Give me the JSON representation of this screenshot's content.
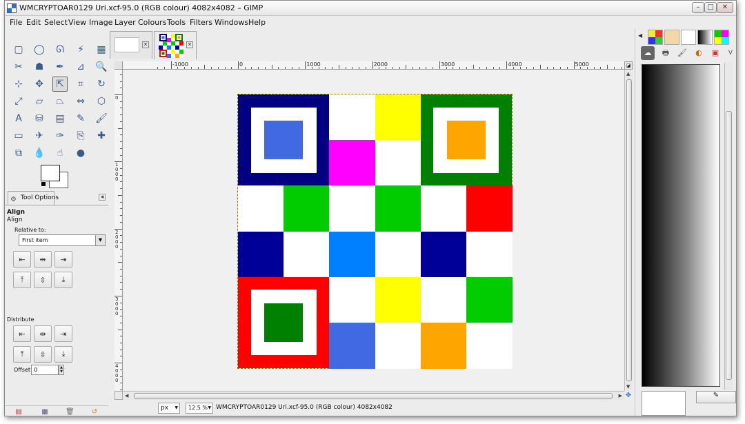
{
  "window": {
    "title": "WMCRYPTOAR0129 Uri.xcf-95.0 (RGB colour) 4082x4082 – GIMP",
    "controls": {
      "minimize": "–",
      "maximize": "□",
      "close": "✕"
    }
  },
  "menubar": {
    "items": [
      "File",
      "Edit",
      "Select",
      "View",
      "Image",
      "Layer",
      "Colours",
      "Tools",
      "Filters",
      "Windows",
      "Help"
    ]
  },
  "toolbox": {
    "tools": [
      {
        "icon": "rect-select-icon",
        "glyph": "▢"
      },
      {
        "icon": "ellipse-select-icon",
        "glyph": "◯"
      },
      {
        "icon": "free-select-icon",
        "glyph": "ᘏ"
      },
      {
        "icon": "fuzzy-select-icon",
        "glyph": "⚡"
      },
      {
        "icon": "color-select-icon",
        "glyph": "▦"
      },
      {
        "icon": "scissors-select-icon",
        "glyph": "✂"
      },
      {
        "icon": "foreground-select-icon",
        "glyph": "☗"
      },
      {
        "icon": "paths-icon",
        "glyph": "✒"
      },
      {
        "icon": "color-picker-icon",
        "glyph": "⊿"
      },
      {
        "icon": "zoom-icon",
        "glyph": "🔍"
      },
      {
        "icon": "measure-icon",
        "glyph": "⊹"
      },
      {
        "icon": "move-icon",
        "glyph": "✥"
      },
      {
        "icon": "align-icon",
        "glyph": "⇱"
      },
      {
        "icon": "crop-icon",
        "glyph": "⌗"
      },
      {
        "icon": "rotate-icon",
        "glyph": "↻"
      },
      {
        "icon": "scale-icon",
        "glyph": "⤢"
      },
      {
        "icon": "shear-icon",
        "glyph": "▱"
      },
      {
        "icon": "perspective-icon",
        "glyph": "⏢"
      },
      {
        "icon": "flip-icon",
        "glyph": "⇔"
      },
      {
        "icon": "cage-icon",
        "glyph": "⬡"
      },
      {
        "icon": "text-icon",
        "glyph": "A"
      },
      {
        "icon": "bucket-fill-icon",
        "glyph": "⛁"
      },
      {
        "icon": "blend-icon",
        "glyph": "▤"
      },
      {
        "icon": "pencil-icon",
        "glyph": "✎"
      },
      {
        "icon": "paintbrush-icon",
        "glyph": "🖌"
      },
      {
        "icon": "eraser-icon",
        "glyph": "▭"
      },
      {
        "icon": "airbrush-icon",
        "glyph": "✈"
      },
      {
        "icon": "ink-icon",
        "glyph": "✑"
      },
      {
        "icon": "clone-icon",
        "glyph": "⎘"
      },
      {
        "icon": "heal-icon",
        "glyph": "✚"
      },
      {
        "icon": "perspective-clone-icon",
        "glyph": "⧉"
      },
      {
        "icon": "blur-icon",
        "glyph": "💧"
      },
      {
        "icon": "smudge-icon",
        "glyph": "☝"
      },
      {
        "icon": "dodge-burn-icon",
        "glyph": "●"
      }
    ],
    "options_tab": "Tool Options",
    "align_title": "Align",
    "align_sub": "Align",
    "relative_to_label": "Relative to:",
    "relative_to_value": "First item",
    "align_buttons": [
      {
        "name": "align-left-edge-button",
        "glyph": "⇤"
      },
      {
        "name": "align-center-vertical-button",
        "glyph": "⇹"
      },
      {
        "name": "align-right-edge-button",
        "glyph": "⇥"
      },
      {
        "name": "align-top-edge-button",
        "glyph": "⤒"
      },
      {
        "name": "align-middle-horizontal-button",
        "glyph": "⇳"
      },
      {
        "name": "align-bottom-edge-button",
        "glyph": "⤓"
      }
    ],
    "distribute_label": "Distribute",
    "distribute_buttons": [
      {
        "name": "distribute-left-edges-button",
        "glyph": "⇤"
      },
      {
        "name": "distribute-centers-button",
        "glyph": "⇹"
      },
      {
        "name": "distribute-right-edges-button",
        "glyph": "⇥"
      },
      {
        "name": "distribute-top-edges-button",
        "glyph": "⤒"
      },
      {
        "name": "distribute-middles-button",
        "glyph": "⇳"
      },
      {
        "name": "distribute-bottom-edges-button",
        "glyph": "⤓"
      }
    ],
    "offset_label": "Offset:",
    "offset_value": "0"
  },
  "image_tabs": [
    {
      "name": "blank-image-tab",
      "close": "✕"
    },
    {
      "name": "qr-pattern-image-tab",
      "close": "✕"
    }
  ],
  "rulers": {
    "horizontal_labels": [
      "-1000",
      "0",
      "1000",
      "2000",
      "3000",
      "4000",
      "5000"
    ],
    "vertical_labels": [
      "0",
      "1000",
      "2000",
      "3000",
      "4000"
    ]
  },
  "image_grid": {
    "rows": [
      [
        "navy-pattern",
        "navy-pattern",
        "#ffffff",
        "#ffff00",
        "green-pattern",
        "green-pattern"
      ],
      [
        "navy-pattern",
        "navy-pattern",
        "#ff00ff",
        "#ffffff",
        "green-pattern",
        "green-pattern"
      ],
      [
        "#ffffff",
        "#00cc00",
        "#ffffff",
        "#00cc00",
        "#ffffff",
        "#ff0000"
      ],
      [
        "#000099",
        "#ffffff",
        "#0080ff",
        "#ffffff",
        "#000099",
        "#ffffff"
      ],
      [
        "red-pattern",
        "red-pattern",
        "#ffffff",
        "#ffff00",
        "#ffffff",
        "#00cc00"
      ],
      [
        "red-pattern",
        "red-pattern",
        "#4169e1",
        "#ffffff",
        "#ffa500",
        "#ffffff"
      ]
    ],
    "finder_patterns": [
      {
        "name": "navy-finder-pattern",
        "outer": "#000080",
        "inner": "#4169e1",
        "row": 0,
        "col": 0
      },
      {
        "name": "green-finder-pattern",
        "outer": "#008000",
        "inner": "#ffa500",
        "row": 0,
        "col": 4
      },
      {
        "name": "red-finder-pattern",
        "outer": "#ff0000",
        "inner": "#008000",
        "row": 4,
        "col": 0
      }
    ]
  },
  "statusbar": {
    "unit": "px",
    "zoom": "12.5 %",
    "text": "WMCRYPTOAR0129 Uri.xcf-95.0 (RGB colour) 4082x4082"
  },
  "dock": {
    "tabs": [
      "patterns-icon",
      "fonts-icon",
      "brushes-icon",
      "gradients-icon",
      "palettes-icon"
    ],
    "brush_row": [
      "☁",
      "🖶",
      "🖌",
      "◐",
      "▣",
      "V"
    ]
  },
  "colors": {
    "accent": "#2b6ee0",
    "chrome": "#ececec"
  }
}
